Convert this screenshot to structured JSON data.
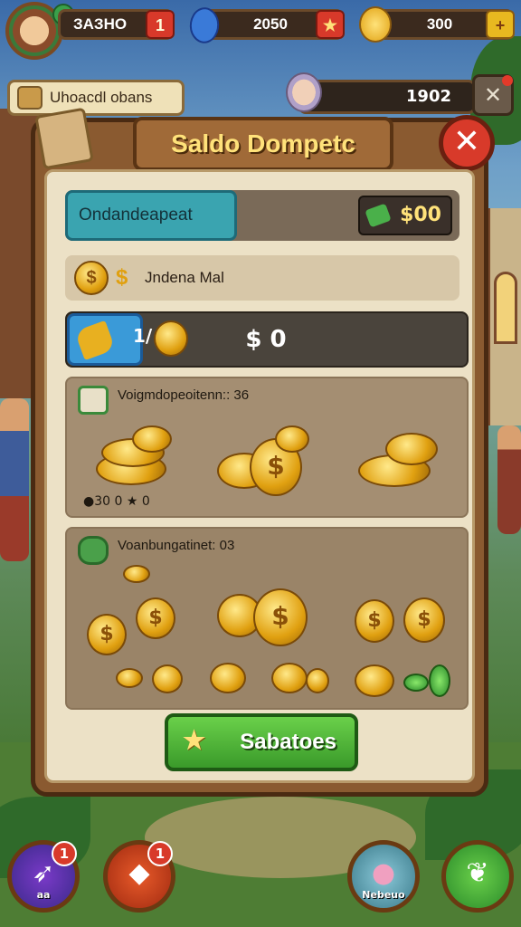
{
  "top_bar": {
    "resource_1": "ЗАЗНО",
    "resource_1_btn": "1",
    "resource_2": "2050",
    "resource_2_btn": "★",
    "resource_3": "300",
    "resource_3_btn": "+",
    "avatar_plus": "+"
  },
  "second_bar": {
    "quest_label": "Uhoacdl obans",
    "score": "1902"
  },
  "panel": {
    "title": "Saldo Dompetc",
    "close_glyph": "✕",
    "balance_label": "Ondandeapeat",
    "balance_value": "$00",
    "mal_label": "Jndena Mal",
    "mal_dollar": "$",
    "amount_small": "1/",
    "amount_value": "$ 0",
    "section_1_title": "Voigmdopeoitenn:: 36",
    "section_1_footer": "●30 0 ★ 0",
    "section_2_title": "Voanbungatinet: 03",
    "save_label": "Sabatoes"
  },
  "bottom_nav": [
    {
      "label": "aa",
      "badge": "1",
      "icon": "rocket-icon"
    },
    {
      "label": "",
      "badge": "1",
      "icon": "gem-shop-icon"
    },
    {
      "label": "Nebeuo",
      "badge": "",
      "icon": "pet-icon"
    },
    {
      "label": "",
      "badge": "",
      "icon": "leaf-icon"
    }
  ],
  "colors": {
    "panel_wood": "#8a5a30",
    "title_gold": "#ffe27a",
    "accent_green": "#3a9a2a",
    "accent_blue": "#3aa4b0",
    "close_red": "#d83a2a"
  }
}
